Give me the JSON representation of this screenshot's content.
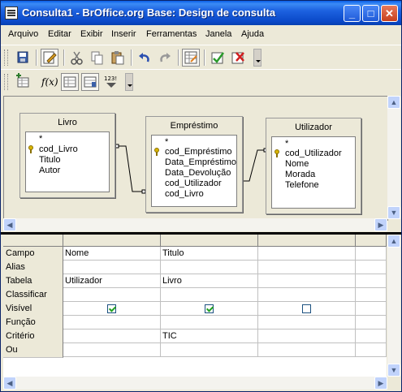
{
  "window": {
    "title": "Consulta1 - BrOffice.org Base: Design de consulta"
  },
  "menu": [
    "Arquivo",
    "Editar",
    "Exibir",
    "Inserir",
    "Ferramentas",
    "Janela",
    "Ajuda"
  ],
  "toolbar2": {
    "limit_label": "123!"
  },
  "tables": [
    {
      "name": "Livro",
      "fields": [
        "*",
        "cod_Livro",
        "Titulo",
        "Autor"
      ],
      "key_index": 1
    },
    {
      "name": "Empréstimo",
      "fields": [
        "*",
        "cod_Empréstimo",
        "Data_Empréstimo",
        "Data_Devolução",
        "cod_Utilizador",
        "cod_Livro"
      ],
      "key_index": 1
    },
    {
      "name": "Utilizador",
      "fields": [
        "*",
        "cod_Utilizador",
        "Nome",
        "Morada",
        "Telefone"
      ],
      "key_index": 1
    }
  ],
  "grid": {
    "rows": [
      "Campo",
      "Alias",
      "Tabela",
      "Classificar",
      "Visível",
      "Função",
      "Critério",
      "Ou"
    ],
    "columns": [
      {
        "Campo": "Nome",
        "Alias": "",
        "Tabela": "Utilizador",
        "Classificar": "",
        "Visível": true,
        "Função": "",
        "Critério": "",
        "Ou": ""
      },
      {
        "Campo": "Titulo",
        "Alias": "",
        "Tabela": "Livro",
        "Classificar": "",
        "Visível": true,
        "Função": "",
        "Critério": "TIC",
        "Ou": ""
      },
      {
        "Campo": "",
        "Alias": "",
        "Tabela": "",
        "Classificar": "",
        "Visível": false,
        "Função": "",
        "Critério": "",
        "Ou": ""
      }
    ]
  }
}
